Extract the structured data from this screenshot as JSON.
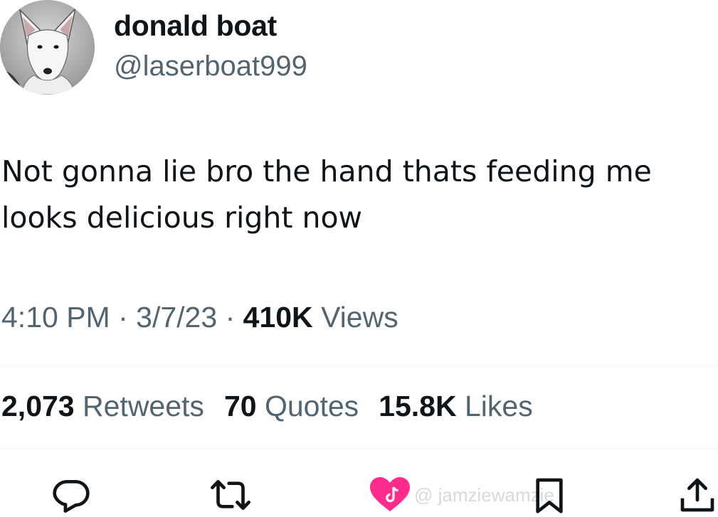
{
  "author": {
    "display_name": "donald boat",
    "handle": "@laserboat999"
  },
  "tweet": {
    "text_lines": [
      "Not gonna lie bro the hand thats feeding me",
      "looks delicious right now"
    ],
    "time": "4:10 PM",
    "date": "3/7/23",
    "separator": "·",
    "views_count": "410K",
    "views_label": "Views"
  },
  "stats": {
    "retweets_count": "2,073",
    "retweets_label": "Retweets",
    "quotes_count": "70",
    "quotes_label": "Quotes",
    "likes_count": "15.8K",
    "likes_label": "Likes"
  },
  "actions": [
    {
      "name": "reply",
      "icon": "reply-icon"
    },
    {
      "name": "retweet",
      "icon": "retweet-icon"
    },
    {
      "name": "bookmark",
      "icon": "bookmark-icon"
    },
    {
      "name": "share",
      "icon": "share-icon"
    }
  ],
  "watermark": {
    "text": "@ jamziewamzie",
    "heart_color": "#fe2c8c"
  },
  "colors": {
    "text_primary": "#0f1419",
    "text_secondary": "#536471",
    "divider": "#eff3f4"
  }
}
